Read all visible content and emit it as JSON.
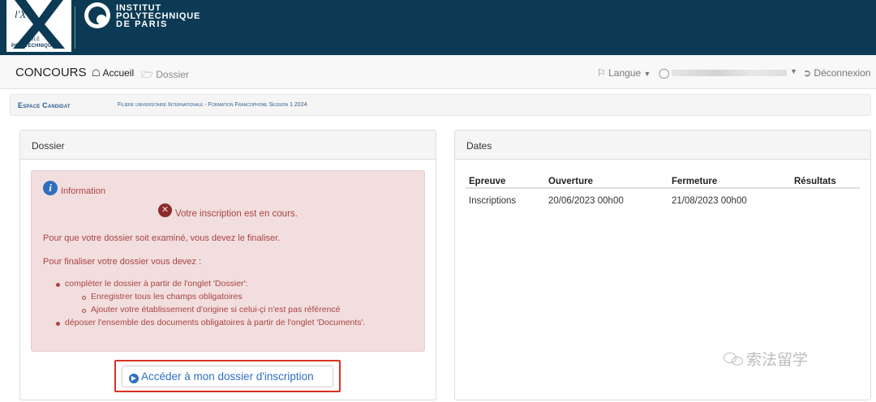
{
  "banner": {
    "logo_lx": "l'X",
    "logo_ecole": "ÉCOLE",
    "logo_polytechnique": "POLYTECHNIQUE",
    "ipp_lines": [
      "INSTITUT",
      "POLYTECHNIQUE",
      "DE PARIS"
    ],
    "bg_color": "#0c3a55"
  },
  "navbar": {
    "brand": "CONCOURS",
    "accueil": "Accueil",
    "dossier": "Dossier",
    "langue": "Langue",
    "deconnexion": "Déconnexion"
  },
  "breadcrumb": {
    "main": "Espace Candidat",
    "sub": "Filière universitaire Internationale - Formation Francophone Session 1 2024"
  },
  "dossier_panel": {
    "title": "Dossier",
    "info_label": "Information",
    "status": "Votre inscription est en cours.",
    "line1": "Pour que votre dossier soit examiné, vous devez le finaliser.",
    "line2": "Pour finaliser votre dossier vous devez :",
    "bullets": [
      "compléter le dossier à partir de l'onglet 'Dossier':",
      "Enregistrer tous les champs obligatoires",
      "Ajouter votre établissement d'origine si celui-çi n'est pas référencé",
      "déposer l'ensemble des documents obligatoires à partir de l'onglet 'Documents'."
    ],
    "button_label": "Accéder à mon dossier d'inscription",
    "alert_color": "#a94442",
    "highlight_color": "#d9321f"
  },
  "dates_panel": {
    "title": "Dates",
    "headers": [
      "Epreuve",
      "Ouverture",
      "Fermeture",
      "Résultats"
    ],
    "rows": [
      [
        "Inscriptions",
        "20/06/2023 00h00",
        "21/08/2023 00h00",
        ""
      ]
    ]
  },
  "watermark": "索法留学"
}
